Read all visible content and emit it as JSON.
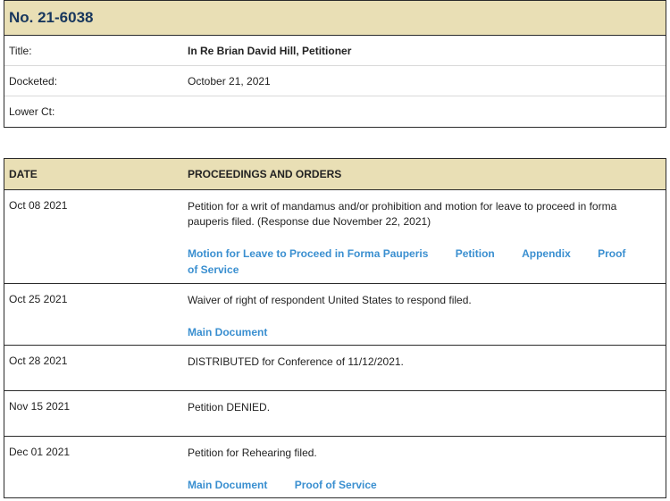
{
  "case": {
    "number": "No. 21-6038",
    "title_label": "Title:",
    "title_value": "In Re Brian David Hill, Petitioner",
    "docketed_label": "Docketed:",
    "docketed_value": "October 21, 2021",
    "lower_ct_label": "Lower Ct:",
    "lower_ct_value": ""
  },
  "proceedings": {
    "header_date": "DATE",
    "header_text": "PROCEEDINGS AND ORDERS",
    "entries": [
      {
        "date": "Oct 08 2021",
        "text": "Petition for a writ of mandamus and/or prohibition and motion for leave to proceed in forma pauperis filed. (Response due November 22, 2021)",
        "links": [
          "Motion for Leave to Proceed in Forma Pauperis",
          "Petition",
          "Appendix",
          "Proof of Service"
        ]
      },
      {
        "date": "Oct 25 2021",
        "text": "Waiver of right of respondent United States to respond filed.",
        "links": [
          "Main Document"
        ]
      },
      {
        "date": "Oct 28 2021",
        "text": "DISTRIBUTED for Conference of 11/12/2021.",
        "links": []
      },
      {
        "date": "Nov 15 2021",
        "text": "Petition DENIED.",
        "links": []
      },
      {
        "date": "Dec 01 2021",
        "text": "Petition for Rehearing filed.",
        "links": [
          "Main Document",
          "Proof of Service"
        ]
      }
    ]
  }
}
